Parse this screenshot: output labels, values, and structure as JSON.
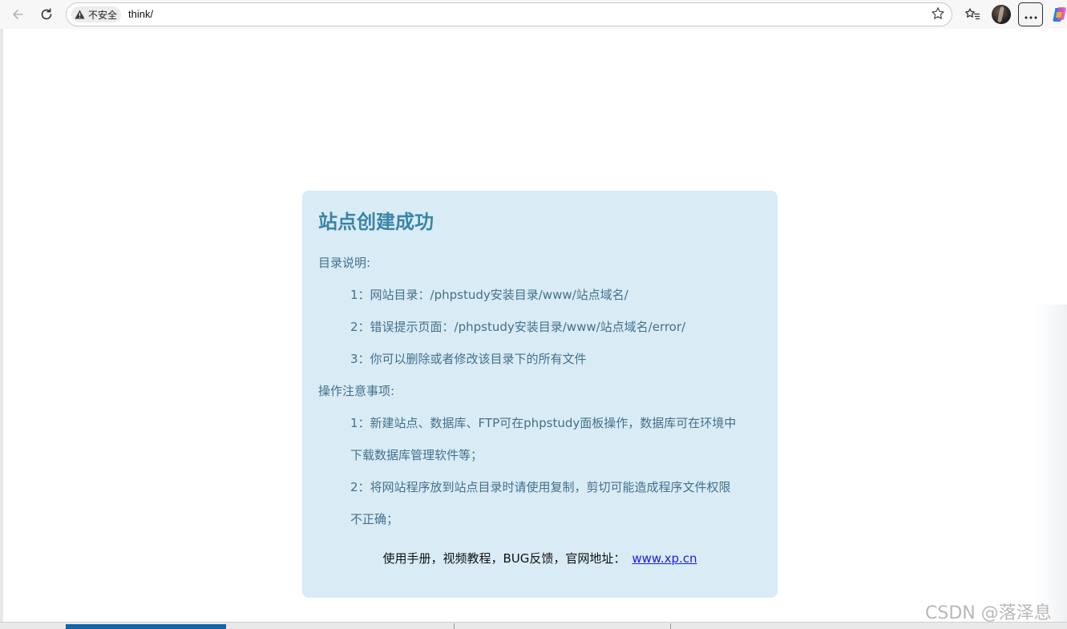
{
  "browser": {
    "security_label": "不安全",
    "url": "think/"
  },
  "page": {
    "title": "站点创建成功",
    "dir_heading": "目录说明:",
    "dir_items": [
      "1：网站目录：/phpstudy安装目录/www/站点域名/",
      "2：错误提示页面：/phpstudy安装目录/www/站点域名/error/",
      "3：你可以删除或者修改该目录下的所有文件"
    ],
    "ops_heading": "操作注意事项:",
    "ops_items": [
      "1：新建站点、数据库、FTP可在phpstudy面板操作，数据库可在环境中",
      "下载数据库管理软件等；",
      "2：将网站程序放到站点目录时请使用复制，剪切可能造成程序文件权限",
      "不正确；"
    ],
    "footer_text": "使用手册，视频教程，BUG反馈，官网地址：",
    "footer_link": "www.xp.cn"
  },
  "watermark": "CSDN @落泽息",
  "colors": {
    "card_bg": "#d9ecf5",
    "title": "#3a84a9",
    "body_text": "#44708c",
    "link": "#1a1aee"
  },
  "icons": [
    "back-arrow-icon",
    "refresh-icon",
    "warning-triangle-icon",
    "star-icon",
    "favorites-icon",
    "more-icon",
    "copilot-icon"
  ]
}
